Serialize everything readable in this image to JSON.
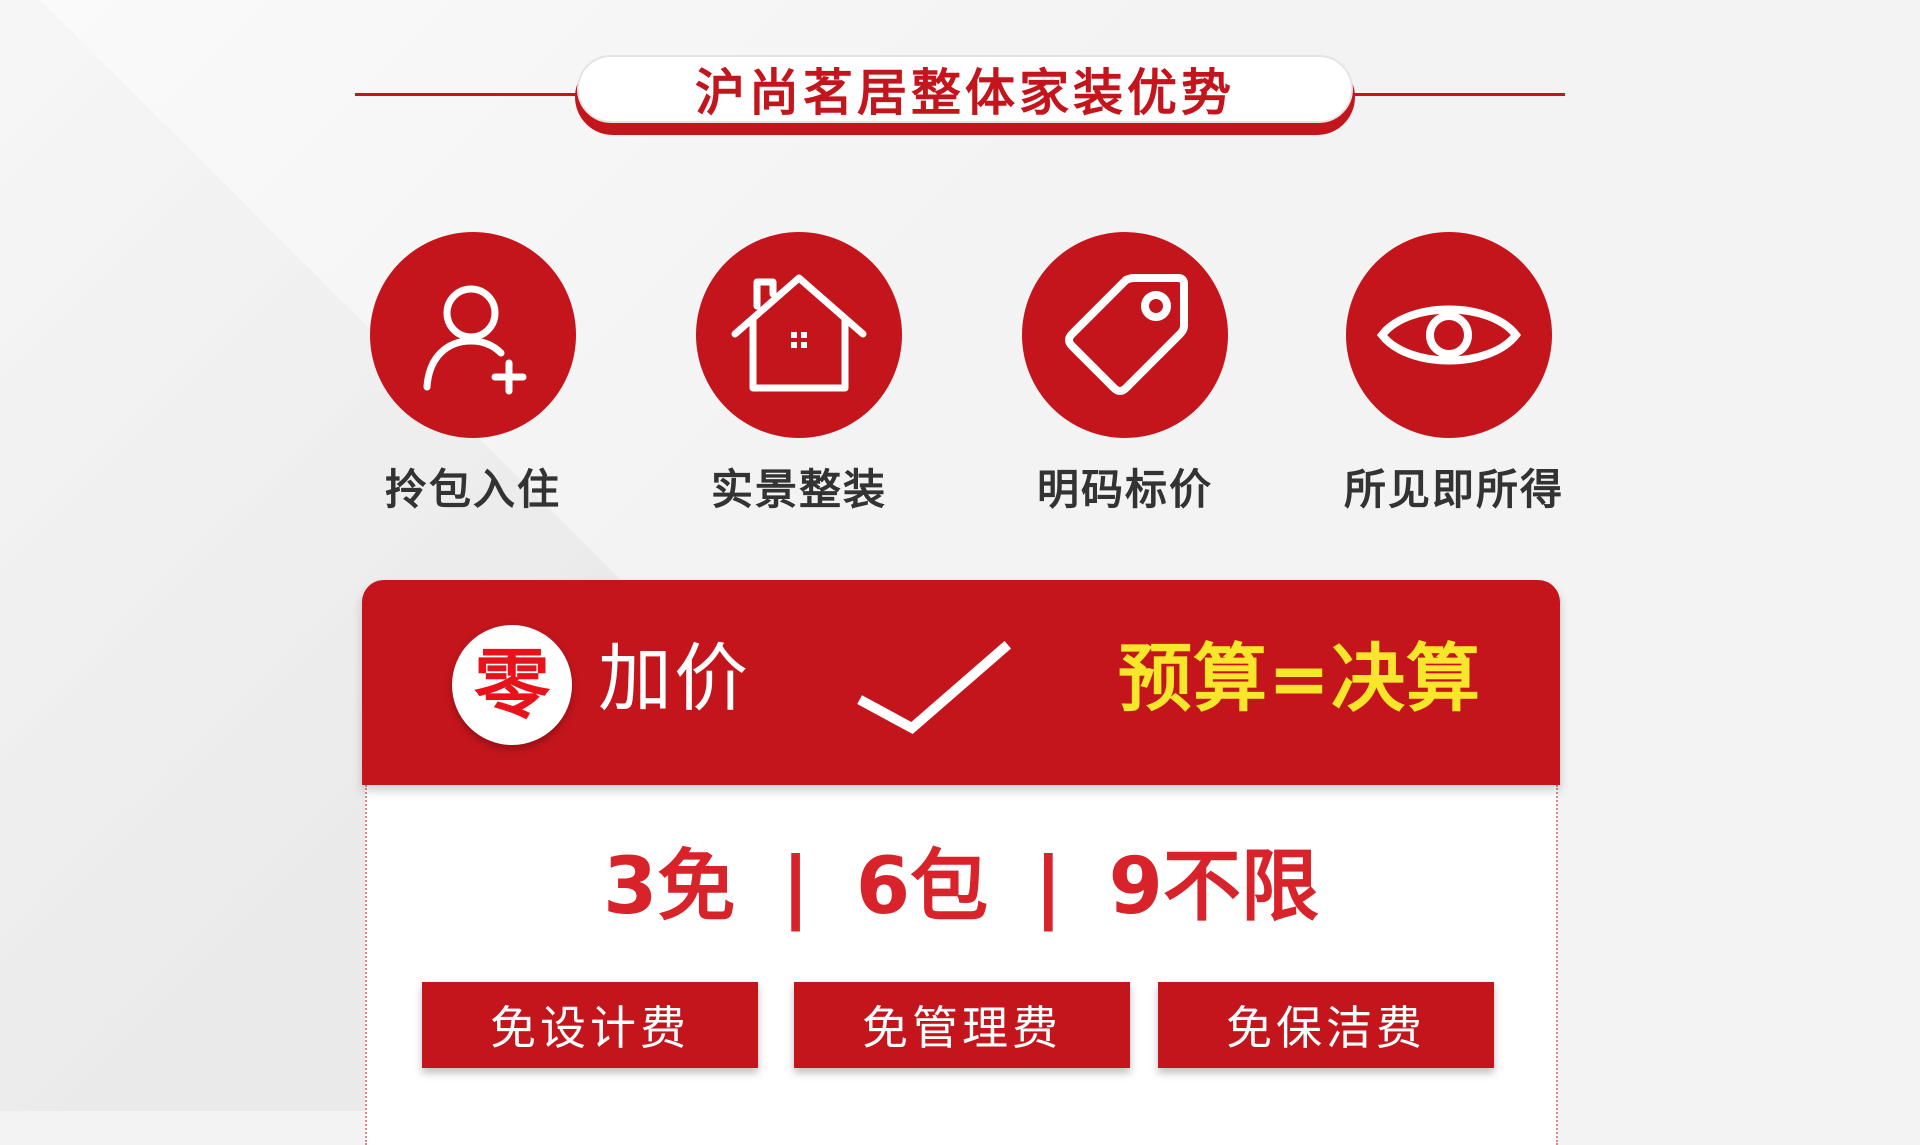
{
  "title": "沪尚茗居整体家装优势",
  "colors": {
    "brand_red": "#c4151c",
    "accent_yellow": "#f7e62a",
    "text_dark": "#333333"
  },
  "features": [
    {
      "icon": "person-add-icon",
      "label": "拎包入住"
    },
    {
      "icon": "house-icon",
      "label": "实景整装"
    },
    {
      "icon": "price-tag-icon",
      "label": "明码标价"
    },
    {
      "icon": "eye-icon",
      "label": "所见即所得"
    }
  ],
  "banner": {
    "zero_char": "零",
    "add_price": "加价",
    "check_icon": "check-icon",
    "budget_text": "预算=决算"
  },
  "stats": {
    "item1": "3免",
    "item2": "6包",
    "item3": "9不限",
    "separator": "|"
  },
  "tags": [
    "免设计费",
    "免管理费",
    "免保洁费"
  ]
}
